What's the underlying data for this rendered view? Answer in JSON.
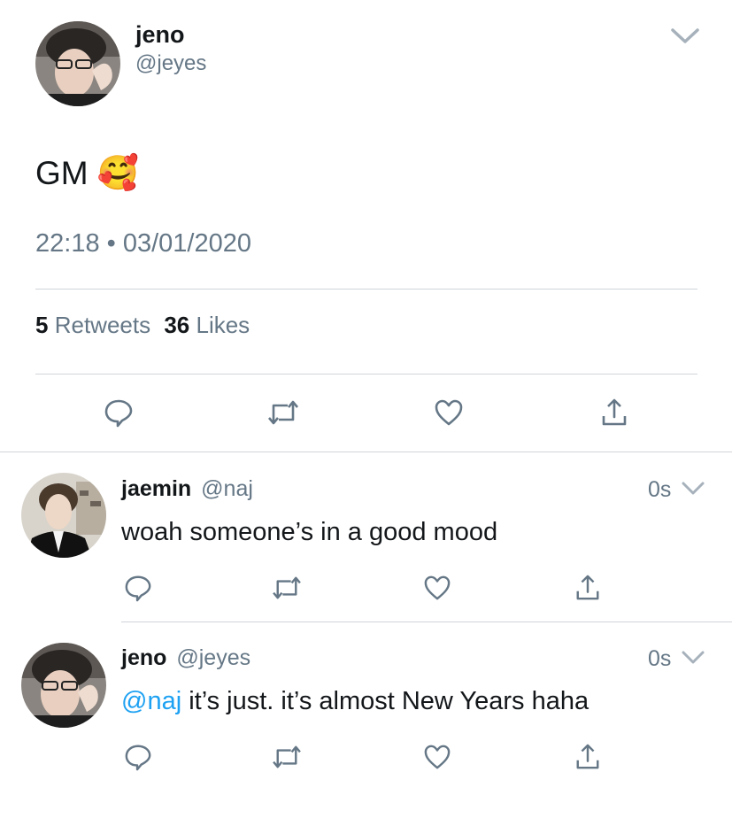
{
  "main_tweet": {
    "name": "jeno",
    "handle": "@jeyes",
    "text": "GM",
    "emoji": "🥰",
    "timestamp": "22:18 • 03/01/2020",
    "retweets_count": "5",
    "retweets_label": "Retweets",
    "likes_count": "36",
    "likes_label": "Likes"
  },
  "replies": [
    {
      "name": "jaemin",
      "handle": "@naj",
      "time": "0s",
      "text": "woah someone’s in a good mood"
    },
    {
      "name": "jeno",
      "handle": "@jeyes",
      "time": "0s",
      "mention": "@naj",
      "text": " it’s just. it’s almost New Years haha"
    }
  ],
  "colors": {
    "text": "#14171a",
    "secondary": "#657786",
    "link": "#1da1f2",
    "divider": "#cfd4d9"
  },
  "icons": [
    "reply-icon",
    "retweet-icon",
    "like-icon",
    "share-icon",
    "chevron-down-icon"
  ]
}
